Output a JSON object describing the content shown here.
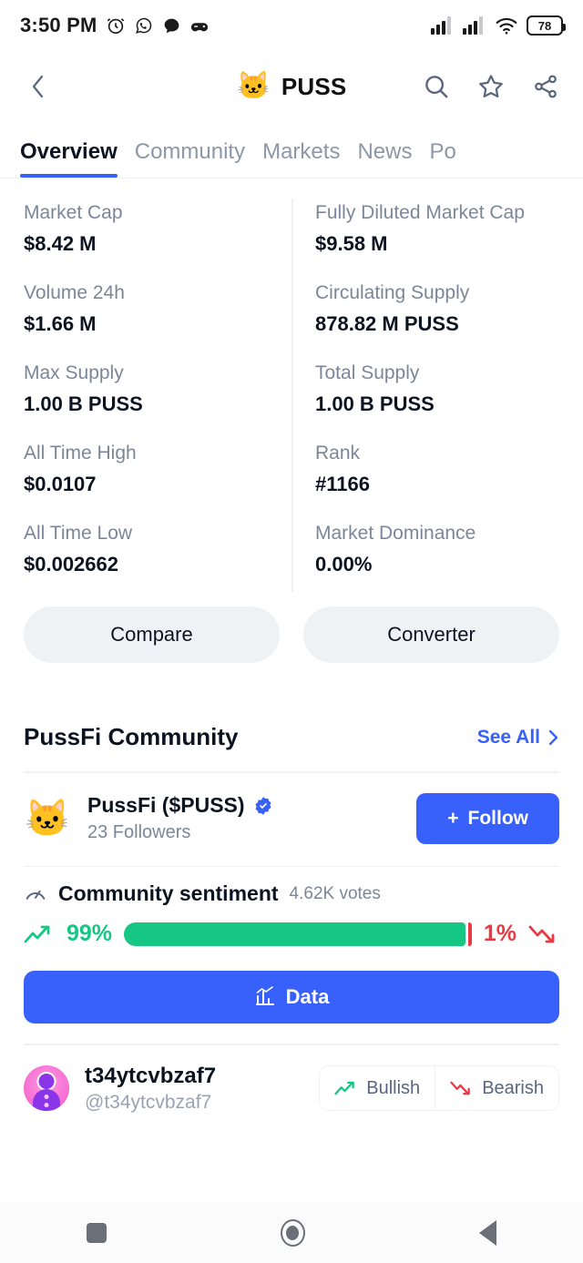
{
  "statusbar": {
    "time": "3:50 PM",
    "icons": [
      "alarm-icon",
      "whatsapp-icon",
      "chat-bubble-icon",
      "game-controller-icon"
    ],
    "signal1": "signal-bars-icon",
    "signal2": "signal-bars-icon",
    "wifi": "wifi-icon",
    "battery_level": "78"
  },
  "header": {
    "back": "back-chevron-icon",
    "coin_emoji": "🐱",
    "title": "PUSS",
    "actions": [
      "search-icon",
      "star-icon",
      "share-icon"
    ]
  },
  "tabs": [
    {
      "label": "Overview",
      "active": true
    },
    {
      "label": "Community",
      "active": false
    },
    {
      "label": "Markets",
      "active": false
    },
    {
      "label": "News",
      "active": false
    },
    {
      "label": "Po",
      "active": false
    }
  ],
  "stats": [
    {
      "label": "Market Cap",
      "value": "$8.42 M"
    },
    {
      "label": "Fully Diluted Market Cap",
      "value": "$9.58 M"
    },
    {
      "label": "Volume 24h",
      "value": "$1.66 M"
    },
    {
      "label": "Circulating Supply",
      "value": "878.82 M PUSS"
    },
    {
      "label": "Max Supply",
      "value": "1.00 B PUSS"
    },
    {
      "label": "Total Supply",
      "value": "1.00 B PUSS"
    },
    {
      "label": "All Time High",
      "value": "$0.0107"
    },
    {
      "label": "Rank",
      "value": "#1166"
    },
    {
      "label": "All Time Low",
      "value": "$0.002662"
    },
    {
      "label": "Market Dominance",
      "value": "0.00%"
    }
  ],
  "actions": {
    "compare": "Compare",
    "converter": "Converter"
  },
  "community": {
    "section_title": "PussFi Community",
    "see_all": "See All",
    "profile": {
      "emoji": "🐱",
      "name": "PussFi ($PUSS)",
      "followers": "23 Followers",
      "follow_button": "Follow",
      "follow_plus": "+"
    },
    "sentiment": {
      "title": "Community sentiment",
      "votes": "4.62K votes",
      "bullish_pct": "99%",
      "bearish_pct": "1%",
      "bullish_value": 99,
      "bearish_value": 1
    },
    "data_button": "Data",
    "post": {
      "name": "t34ytcvbzaf7",
      "handle": "@t34ytcvbzaf7",
      "bullish_label": "Bullish",
      "bearish_label": "Bearish"
    }
  },
  "navbar": {
    "recents": "square-recents-icon",
    "home": "circle-home-icon",
    "back": "triangle-back-icon"
  },
  "colors": {
    "accent_blue": "#3861fb",
    "green": "#16c784",
    "red": "#ea3943",
    "muted": "#7b8799",
    "surface": "#eff2f5"
  }
}
